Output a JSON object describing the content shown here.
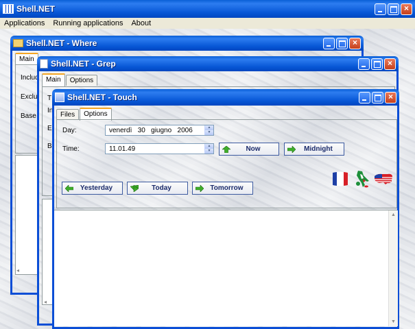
{
  "main_window": {
    "title": "Shell.NET",
    "menu": [
      "Applications",
      "Running applications",
      "About"
    ]
  },
  "where_window": {
    "title": "Shell.NET - Where",
    "tabs": [
      "Main"
    ],
    "labels": [
      "Includ",
      "Exclu",
      "Base c"
    ]
  },
  "grep_window": {
    "title": "Shell.NET - Grep",
    "tabs": [
      "Main",
      "Options"
    ],
    "labels": [
      "T",
      "In",
      "E",
      "B"
    ]
  },
  "touch_window": {
    "title": "Shell.NET - Touch",
    "tabs": [
      "Files",
      "Options"
    ],
    "day_label": "Day:",
    "day_value": "venerdì   30   giugno   2006",
    "time_label": "Time:",
    "time_value": "11.01.49",
    "buttons": {
      "now": "Now",
      "midnight": "Midnight",
      "yesterday": "Yesterday",
      "today": "Today",
      "tomorrow": "Tomorrow"
    },
    "flags": [
      "france-flag",
      "italy-flag",
      "usa-flag"
    ]
  },
  "colors": {
    "title_blue": "#0857d6",
    "close_red": "#c5401c",
    "arrow_green": "#3fae2a"
  }
}
